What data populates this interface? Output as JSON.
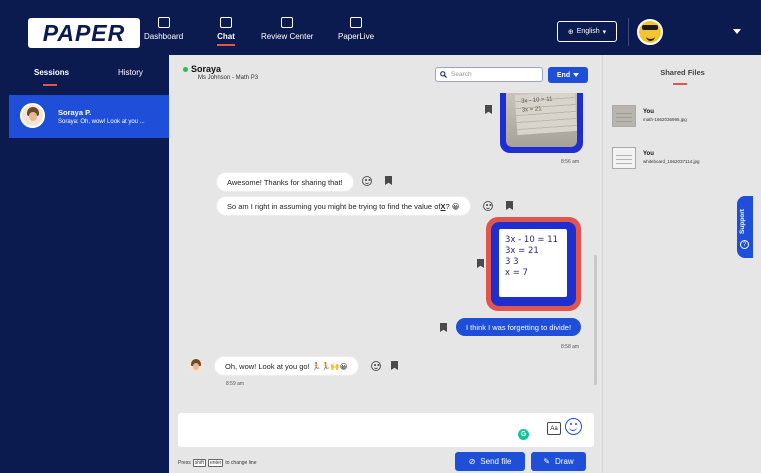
{
  "brand": {
    "logo_text": "PAPER"
  },
  "nav": {
    "items": [
      {
        "label": "Dashboard",
        "icon": "chart-icon"
      },
      {
        "label": "Chat",
        "icon": "chat-icon",
        "active": true
      },
      {
        "label": "Review Center",
        "icon": "document-icon"
      },
      {
        "label": "PaperLive",
        "icon": "video-icon"
      }
    ],
    "language": "English"
  },
  "sidebar": {
    "tabs": [
      "Sessions",
      "History"
    ],
    "sessions": [
      {
        "name": "Soraya P.",
        "preview": "Soraya: Oh, wow! Look at you ..."
      }
    ]
  },
  "chat": {
    "student_name": "Soraya",
    "subtitle": "Ms Johnson - Math P3",
    "search_placeholder": "Search",
    "end_label": "End",
    "top_image_text": [
      "3x - 10 = 11",
      "3x = 21"
    ],
    "messages": {
      "time_1": "8:56 am",
      "msg_1": "Awesome! Thanks for sharing that!",
      "msg_2": "So am I right in assuming you might be trying to find the value of ",
      "msg_2_var": "X",
      "msg_2_end": "? 😀",
      "image_lines": [
        "3x - 10 = 11",
        "3x = 21",
        "3     3",
        "x = 7"
      ],
      "msg_3": "I think I was forgetting to divide!",
      "time_2": "8:58 am",
      "msg_4": "Oh, wow! Look at you go! 🏃🏃🙌😀",
      "time_3": "8:59 am"
    },
    "composer": {
      "placeholder": "",
      "hint_pre": "Press",
      "hint_key_1": "shift",
      "hint_key_2": "enter",
      "hint_post": "to change line",
      "aa_label": "Aa",
      "send_file_label": "Send file",
      "draw_label": "Draw"
    }
  },
  "shared_files": {
    "title": "Shared Files",
    "files": [
      {
        "who": "You",
        "name": "math-1662036995.jpg"
      },
      {
        "who": "You",
        "name": "whiteboard_1662037114.jpg"
      }
    ]
  },
  "support_label": "Support",
  "colors": {
    "navy": "#0b1a4f",
    "accent_blue": "#1f4fd8",
    "accent_red": "#e0554d",
    "panel_gray": "#e6e6e6"
  }
}
